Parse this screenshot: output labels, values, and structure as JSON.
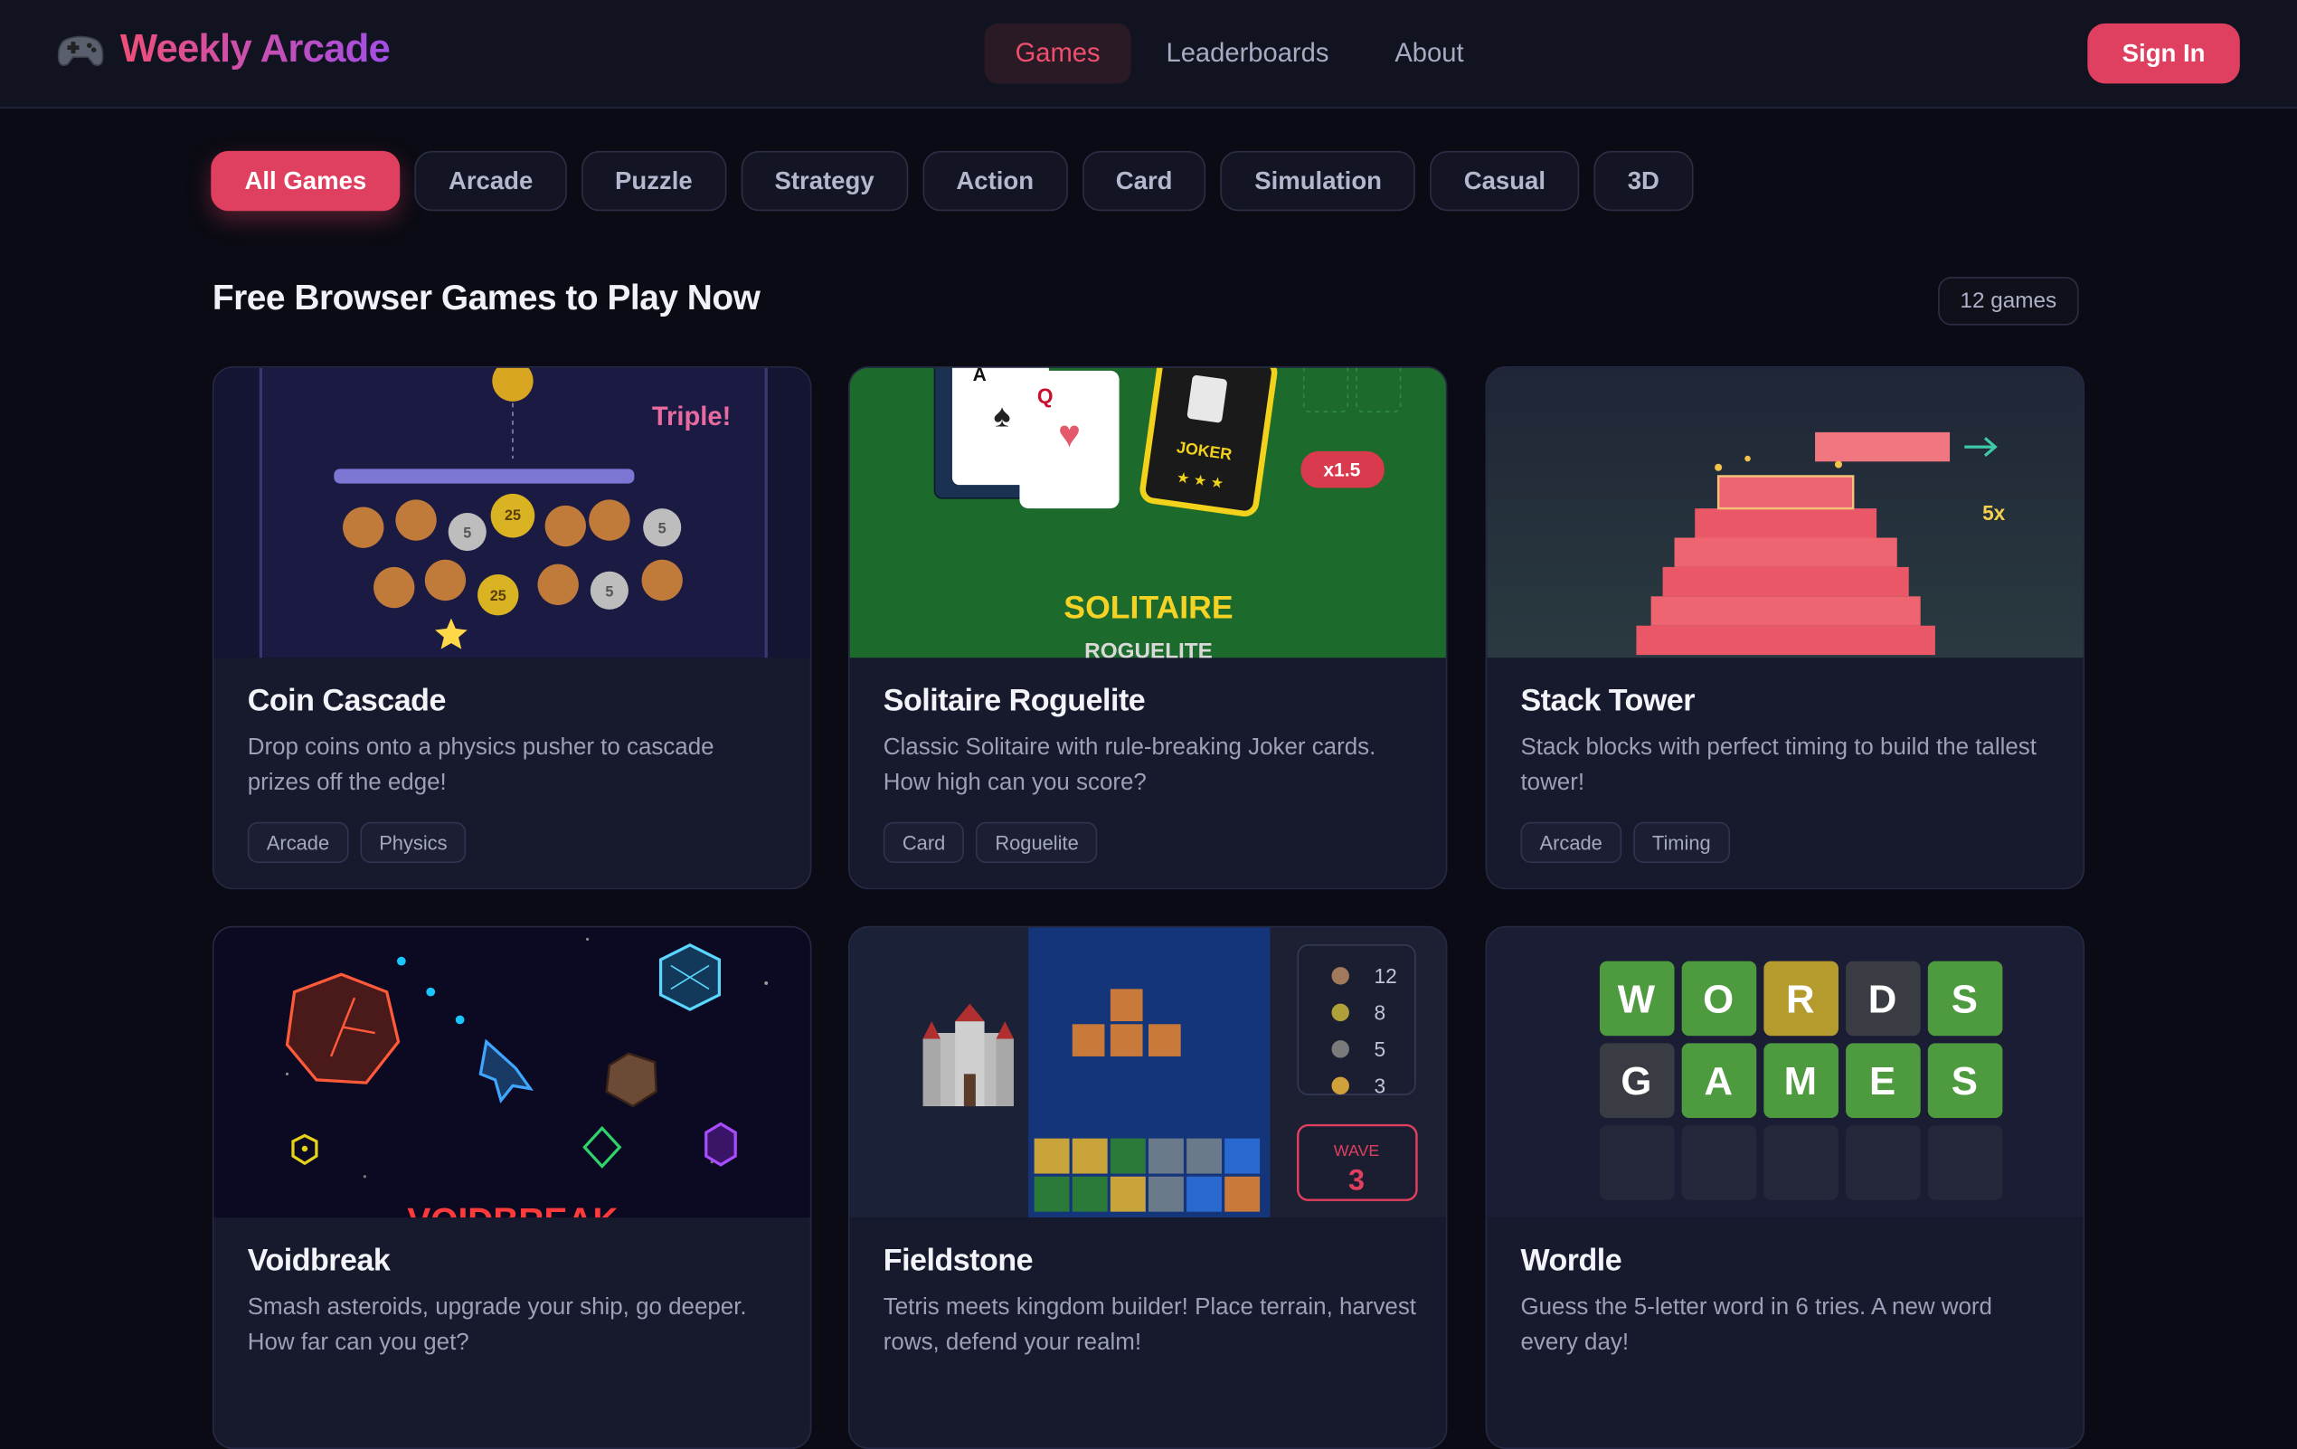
{
  "brand": {
    "name": "Weekly Arcade",
    "icon": "gamepad-icon"
  },
  "nav": [
    {
      "label": "Games",
      "active": true
    },
    {
      "label": "Leaderboards",
      "active": false
    },
    {
      "label": "About",
      "active": false
    }
  ],
  "header": {
    "signin_label": "Sign In"
  },
  "filters": [
    "All Games",
    "Arcade",
    "Puzzle",
    "Strategy",
    "Action",
    "Card",
    "Simulation",
    "Casual",
    "3D"
  ],
  "section": {
    "title": "Free Browser Games to Play Now",
    "count": "12 games"
  },
  "games": [
    {
      "title": "Coin Cascade",
      "desc": "Drop coins onto a physics pusher to cascade prizes off the edge!",
      "tags": [
        "Arcade",
        "Physics"
      ],
      "art": {
        "banner": "Triple!",
        "coin_values": [
          "25",
          "5"
        ]
      }
    },
    {
      "title": "Solitaire Roguelite",
      "desc": "Classic Solitaire with rule-breaking Joker cards. How high can you score?",
      "tags": [
        "Card",
        "Roguelite"
      ],
      "art": {
        "logo_line1": "SOLITAIRE",
        "logo_line2": "ROGUELITE",
        "multiplier": "x1.5",
        "joker": "JOKER",
        "card_a": "A",
        "card_q": "Q"
      }
    },
    {
      "title": "Stack Tower",
      "desc": "Stack blocks with perfect timing to build the tallest tower!",
      "tags": [
        "Arcade",
        "Timing"
      ],
      "art": {
        "combo": "5x"
      }
    },
    {
      "title": "Voidbreak",
      "desc": "Smash asteroids, upgrade your ship, go deeper. How far can you get?",
      "tags": [],
      "art": {
        "logo": "VOIDBREAK"
      }
    },
    {
      "title": "Fieldstone",
      "desc": "Tetris meets kingdom builder! Place terrain, harvest rows, defend your realm!",
      "tags": [],
      "art": {
        "resources": [
          "12",
          "8",
          "5",
          "3"
        ],
        "wave_label": "WAVE",
        "wave_number": "3"
      }
    },
    {
      "title": "Wordle",
      "desc": "Guess the 5-letter word in 6 tries. A new word every day!",
      "tags": [],
      "art": {
        "row1": [
          "W",
          "O",
          "R",
          "D",
          "S"
        ],
        "row2": [
          "G",
          "A",
          "M",
          "E",
          "S"
        ]
      }
    }
  ],
  "colors": {
    "accent": "#e0405f",
    "background": "#0a0b14",
    "card": "#17192c"
  }
}
